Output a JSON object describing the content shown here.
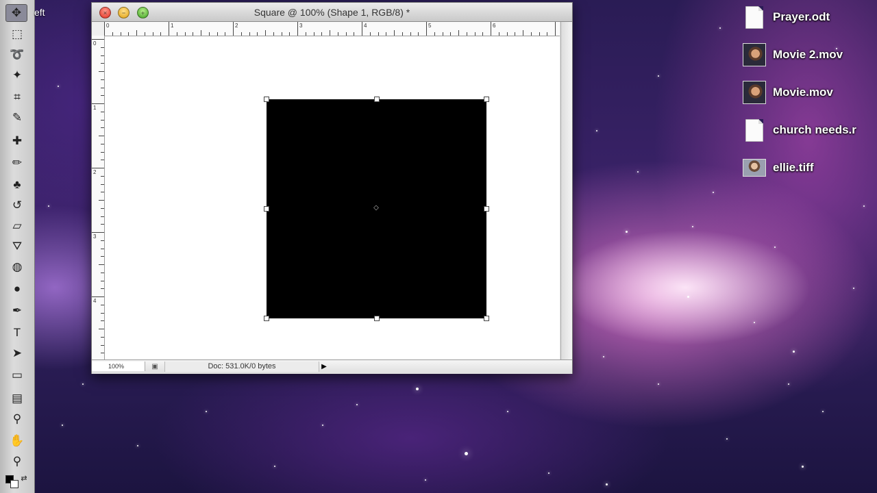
{
  "desktop": {
    "partial_label": "eft",
    "items": [
      {
        "label": "Prayer.odt",
        "icon": "document-icon"
      },
      {
        "label": "Movie 2.mov",
        "icon": "movie-thumbnail-icon"
      },
      {
        "label": "Movie.mov",
        "icon": "movie-thumbnail-icon"
      },
      {
        "label": "church needs.r",
        "icon": "document-icon"
      },
      {
        "label": "ellie.tiff",
        "icon": "image-thumbnail-icon"
      }
    ]
  },
  "window": {
    "title": "Square @ 100% (Shape 1, RGB/8) *",
    "close_symbol": "×",
    "minimize_symbol": "−",
    "zoom_symbol": "+"
  },
  "ruler": {
    "top_numbers": [
      "0",
      "1",
      "2",
      "3",
      "4",
      "5",
      "6"
    ],
    "left_numbers": [
      "0",
      "1",
      "2",
      "3",
      "4"
    ]
  },
  "statusbar": {
    "zoom": "100%",
    "doc_info": "Doc: 531.0K/0 bytes",
    "arrow_symbol": "▶"
  },
  "tools": [
    {
      "name": "move-tool-icon",
      "glyph": "✥"
    },
    {
      "name": "marquee-tool-icon",
      "glyph": "⬚"
    },
    {
      "name": "lasso-tool-icon",
      "glyph": "➰"
    },
    {
      "name": "magic-wand-tool-icon",
      "glyph": "✦"
    },
    {
      "name": "crop-tool-icon",
      "glyph": "⌗"
    },
    {
      "name": "eyedropper-tool-icon",
      "glyph": "✎"
    },
    {
      "name": "healing-brush-tool-icon",
      "glyph": "✚"
    },
    {
      "name": "brush-tool-icon",
      "glyph": "✏"
    },
    {
      "name": "clone-stamp-tool-icon",
      "glyph": "♣"
    },
    {
      "name": "history-brush-tool-icon",
      "glyph": "↺"
    },
    {
      "name": "eraser-tool-icon",
      "glyph": "▱"
    },
    {
      "name": "paint-bucket-tool-icon",
      "glyph": "⛛"
    },
    {
      "name": "blur-tool-icon",
      "glyph": "◍"
    },
    {
      "name": "dodge-tool-icon",
      "glyph": "●"
    },
    {
      "name": "pen-tool-icon",
      "glyph": "✒"
    },
    {
      "name": "type-tool-icon",
      "glyph": "T"
    },
    {
      "name": "path-selection-tool-icon",
      "glyph": "➤"
    },
    {
      "name": "rectangle-shape-tool-icon",
      "glyph": "▭"
    },
    {
      "name": "notes-tool-icon",
      "glyph": "▤"
    },
    {
      "name": "eyedropper2-tool-icon",
      "glyph": "⚲"
    },
    {
      "name": "hand-tool-icon",
      "glyph": "✋"
    },
    {
      "name": "zoom-tool-icon",
      "glyph": "⚲"
    }
  ],
  "colors": {
    "foreground": "#000000",
    "background": "#ffffff",
    "shape_fill": "#000000"
  }
}
